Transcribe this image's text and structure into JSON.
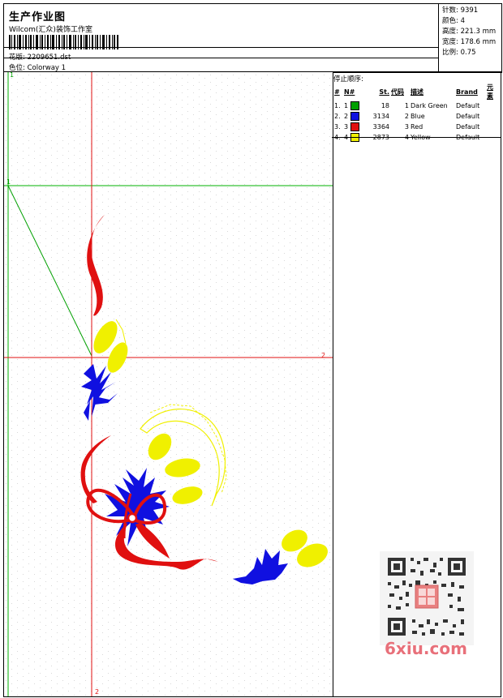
{
  "header": {
    "title": "生产作业图",
    "subtitle": "Wilcom(汇众)装饰工作室",
    "design_label": "花版:",
    "design_value": "2209651.dst",
    "colorway_label": "色位:",
    "colorway_value": "Colorway 1"
  },
  "stats": [
    {
      "label": "针数:",
      "value": "9391"
    },
    {
      "label": "颜色:",
      "value": "4"
    },
    {
      "label": "高度:",
      "value": "221.3 mm"
    },
    {
      "label": "宽度:",
      "value": "178.6 mm"
    },
    {
      "label": "比例:",
      "value": "0.75"
    }
  ],
  "stop_sequence": {
    "heading": "停止顺序:",
    "columns": [
      "#",
      "N#",
      "St.",
      "代码",
      "描述",
      "Brand",
      "元素"
    ],
    "rows": [
      {
        "idx": "1.",
        "n": "1",
        "color": "#00a000",
        "st": "18",
        "code": "1",
        "desc": "Dark Green",
        "brand": "Default"
      },
      {
        "idx": "2.",
        "n": "2",
        "color": "#1010e0",
        "st": "3134",
        "code": "2",
        "desc": "Blue",
        "brand": "Default"
      },
      {
        "idx": "3.",
        "n": "3",
        "color": "#e01010",
        "st": "3364",
        "code": "3",
        "desc": "Red",
        "brand": "Default"
      },
      {
        "idx": "4.",
        "n": "4",
        "color": "#f0f000",
        "st": "2873",
        "code": "4",
        "desc": "Yellow",
        "brand": "Default"
      }
    ]
  },
  "canvas_markers": {
    "green_top": "1",
    "green_mid": "1",
    "red_right": "2",
    "red_bottom": "2"
  },
  "watermark": {
    "site": "6xiu.com"
  },
  "colors": {
    "red": "#e01010",
    "blue": "#1010e0",
    "yellow": "#f0f000",
    "green": "#00a000"
  }
}
